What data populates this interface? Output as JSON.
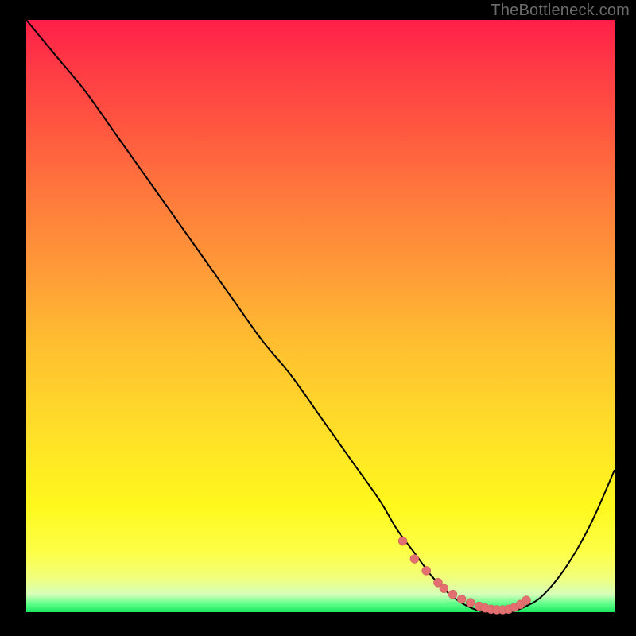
{
  "watermark": "TheBottleneck.com",
  "colors": {
    "background": "#000000",
    "gradient_top": "#ff1f49",
    "gradient_bottom": "#18e860",
    "curve": "#000000",
    "dots": "#e27070"
  },
  "chart_data": {
    "type": "line",
    "title": "",
    "xlabel": "",
    "ylabel": "",
    "xlim": [
      0,
      100
    ],
    "ylim": [
      0,
      100
    ],
    "grid": false,
    "legend": false,
    "series": [
      {
        "name": "bottleneck-curve",
        "x": [
          0,
          5,
          10,
          15,
          20,
          25,
          30,
          35,
          40,
          45,
          50,
          55,
          60,
          63,
          66,
          69,
          72,
          75,
          78,
          80,
          82,
          85,
          88,
          92,
          96,
          100
        ],
        "y": [
          100,
          94,
          88,
          81,
          74,
          67,
          60,
          53,
          46,
          40,
          33,
          26,
          19,
          14,
          10,
          6,
          3,
          1,
          0,
          0,
          0,
          1,
          3,
          8,
          15,
          24
        ]
      }
    ],
    "dot_markers": {
      "name": "highlight-dots",
      "x": [
        64.0,
        66.0,
        68.0,
        70.0,
        71.0,
        72.5,
        74.0,
        75.5,
        77.0,
        78.0,
        79.0,
        80.0,
        81.0,
        82.0,
        83.0,
        84.0,
        85.0
      ],
      "y": [
        12.0,
        9.0,
        7.0,
        5.0,
        4.0,
        3.0,
        2.2,
        1.6,
        1.0,
        0.7,
        0.5,
        0.4,
        0.4,
        0.5,
        0.8,
        1.3,
        2.0
      ]
    }
  }
}
